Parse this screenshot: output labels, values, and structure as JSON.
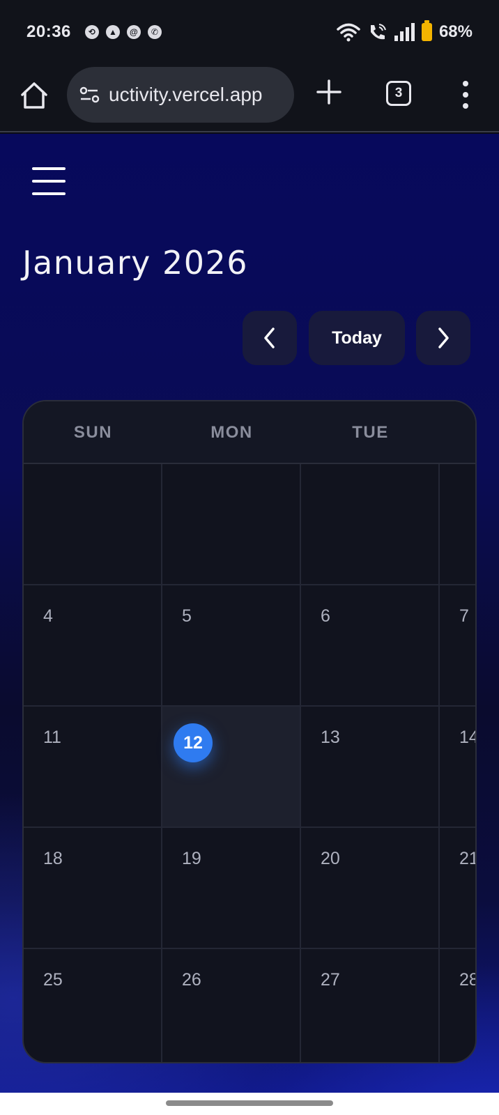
{
  "status_bar": {
    "time": "20:36",
    "battery_percent": "68%",
    "notifications": [
      "sync-icon",
      "compass-icon",
      "at-icon",
      "messenger-icon"
    ]
  },
  "browser": {
    "url": "uctivity.vercel.app",
    "tab_count": "3"
  },
  "calendar": {
    "month_title": "January 2026",
    "today_label": "Today",
    "weekdays": [
      "SUN",
      "MON",
      "TUE"
    ],
    "today_day": "12",
    "accent_color": "#2f7bf0",
    "rows": [
      [
        "",
        "",
        "",
        ""
      ],
      [
        "4",
        "5",
        "6",
        "7"
      ],
      [
        "11",
        "12",
        "13",
        "14"
      ],
      [
        "18",
        "19",
        "20",
        "21"
      ],
      [
        "25",
        "26",
        "27",
        "28"
      ]
    ]
  }
}
